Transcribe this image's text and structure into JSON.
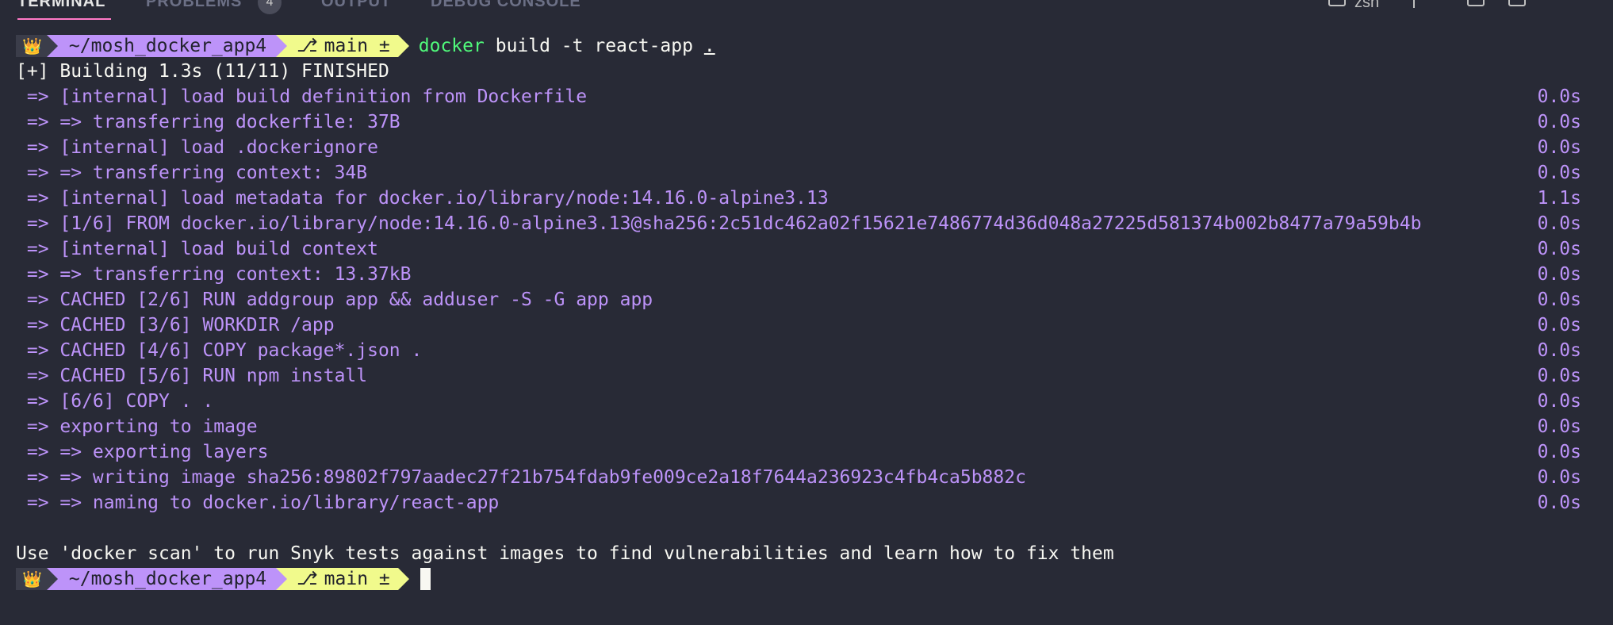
{
  "panel_tabs": {
    "terminal": "TERMINAL",
    "problems": "PROBLEMS",
    "problems_count": "4",
    "output": "OUTPUT",
    "debug_console": "DEBUG CONSOLE",
    "shell_label": "zsh"
  },
  "prompt": {
    "icon": "crown-icon",
    "crown_glyph": "👑",
    "path": "~/mosh_docker_app4",
    "branch_glyph": "⎇",
    "branch": "main ±"
  },
  "command": {
    "program": "docker",
    "args": "build -t react-app",
    "dot": "."
  },
  "build_header": "[+] Building 1.3s (11/11) FINISHED",
  "build_steps": [
    {
      "text": " => [internal] load build definition from Dockerfile",
      "duration": "0.0s"
    },
    {
      "text": " => => transferring dockerfile: 37B",
      "duration": "0.0s"
    },
    {
      "text": " => [internal] load .dockerignore",
      "duration": "0.0s"
    },
    {
      "text": " => => transferring context: 34B",
      "duration": "0.0s"
    },
    {
      "text": " => [internal] load metadata for docker.io/library/node:14.16.0-alpine3.13",
      "duration": "1.1s"
    },
    {
      "text": " => [1/6] FROM docker.io/library/node:14.16.0-alpine3.13@sha256:2c51dc462a02f15621e7486774d36d048a27225d581374b002b8477a79a59b4b",
      "duration": "0.0s"
    },
    {
      "text": " => [internal] load build context",
      "duration": "0.0s"
    },
    {
      "text": " => => transferring context: 13.37kB",
      "duration": "0.0s"
    },
    {
      "text": " => CACHED [2/6] RUN addgroup app && adduser -S -G app app",
      "duration": "0.0s"
    },
    {
      "text": " => CACHED [3/6] WORKDIR /app",
      "duration": "0.0s"
    },
    {
      "text": " => CACHED [4/6] COPY package*.json .",
      "duration": "0.0s"
    },
    {
      "text": " => CACHED [5/6] RUN npm install",
      "duration": "0.0s"
    },
    {
      "text": " => [6/6] COPY . .",
      "duration": "0.0s"
    },
    {
      "text": " => exporting to image",
      "duration": "0.0s"
    },
    {
      "text": " => => exporting layers",
      "duration": "0.0s"
    },
    {
      "text": " => => writing image sha256:89802f797aadec27f21b754fdab9fe009ce2a18f7644a236923c4fb4ca5b882c",
      "duration": "0.0s"
    },
    {
      "text": " => => naming to docker.io/library/react-app",
      "duration": "0.0s"
    }
  ],
  "footer_message": "Use 'docker scan' to run Snyk tests against images to find vulnerabilities and learn how to fix them",
  "colors": {
    "background": "#282a36",
    "purple": "#bd93f9",
    "green": "#50fa7b",
    "yellow": "#f1fa8c"
  }
}
